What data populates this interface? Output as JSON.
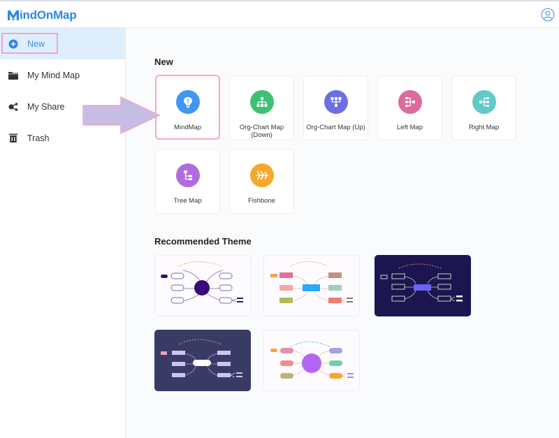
{
  "app": {
    "name": "MindOnMap",
    "logo_letter": "M",
    "logo_rest": "indOnMap"
  },
  "header": {
    "avatar_icon": "user-circle-icon"
  },
  "sidebar": {
    "items": [
      {
        "label": "New",
        "icon": "plus-circle-icon",
        "active": true
      },
      {
        "label": "My Mind Map",
        "icon": "folder-icon",
        "active": false
      },
      {
        "label": "My Share",
        "icon": "share-icon",
        "active": false
      },
      {
        "label": "Trash",
        "icon": "trash-icon",
        "active": false
      }
    ]
  },
  "main": {
    "new_section": {
      "title": "New",
      "templates": [
        {
          "label": "MindMap",
          "icon": "lightbulb-brain-icon",
          "color": "#4096f3",
          "selected": true
        },
        {
          "label": "Org-Chart Map (Down)",
          "icon": "org-chart-down-icon",
          "color": "#3fc173",
          "selected": false
        },
        {
          "label": "Org-Chart Map (Up)",
          "icon": "org-chart-up-icon",
          "color": "#6e6ee3",
          "selected": false
        },
        {
          "label": "Left Map",
          "icon": "left-map-icon",
          "color": "#de6b9b",
          "selected": false
        },
        {
          "label": "Right Map",
          "icon": "right-map-icon",
          "color": "#5fcbc9",
          "selected": false
        },
        {
          "label": "Tree Map",
          "icon": "tree-map-icon",
          "color": "#b26ae0",
          "selected": false
        },
        {
          "label": "Fishbone",
          "icon": "fishbone-icon",
          "color": "#f6a82a",
          "selected": false
        }
      ]
    },
    "theme_section": {
      "title": "Recommended Theme",
      "themes": [
        {
          "name": "theme-purple-classic",
          "bg": "#fdfbfe",
          "center": "#3b0a7a"
        },
        {
          "name": "theme-colorful-blocks",
          "bg": "#fdfbfe",
          "center": "#2aa8f5"
        },
        {
          "name": "theme-dark-navy",
          "bg": "#1c1650",
          "center": "#6c62f7"
        },
        {
          "name": "theme-slate-dark",
          "bg": "#3a3a66",
          "center": "#ffffff"
        },
        {
          "name": "theme-pastel-bubble",
          "bg": "#fdfbfe",
          "center": "#b267f2"
        }
      ]
    }
  },
  "colors": {
    "accent": "#3a8de6",
    "highlight": "#f1a7c8",
    "arrow_fill": "#c6bde4"
  }
}
